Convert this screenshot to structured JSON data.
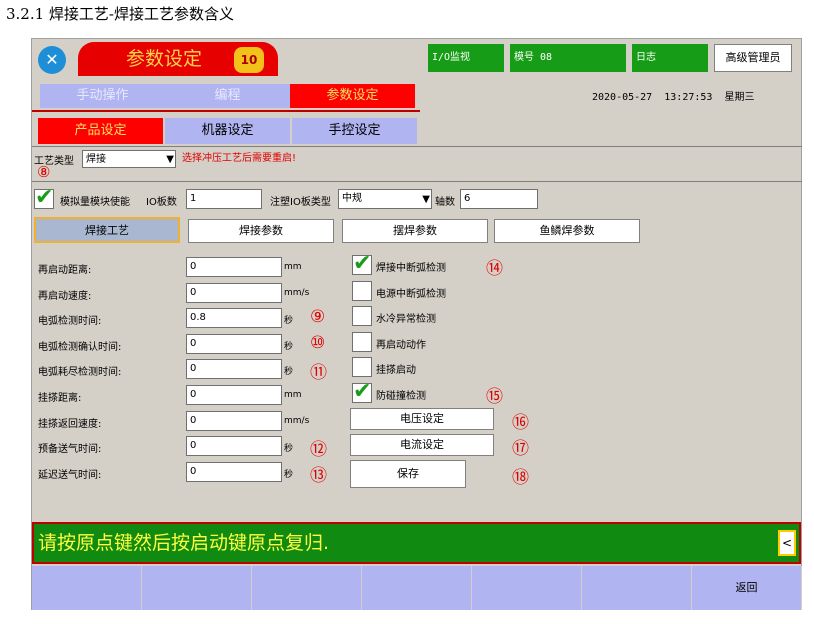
{
  "heading": "3.2.1 焊接工艺-焊接工艺参数含义",
  "top": {
    "title": "参数设定",
    "page_badge": "10",
    "io_monitor": "I/O监视",
    "model": "模号 08",
    "log": "日志",
    "admin": "高级管理员",
    "date": "2020-05-27",
    "time": "13:27:53",
    "weekday": "星期三"
  },
  "main_tabs": [
    "手动操作",
    "编程",
    "参数设定"
  ],
  "sub_tabs": [
    "产品设定",
    "机器设定",
    "手控设定"
  ],
  "process": {
    "label": "工艺类型",
    "value": "焊接",
    "warning": "选择冲压工艺后需要重启!",
    "marker": "⑧"
  },
  "config": {
    "analog_label": "模拟量模块使能",
    "io_count_label": "IO板数",
    "io_count_value": "1",
    "io_type_label": "注塑IO板类型",
    "io_type_value": "中规",
    "axis_label": "轴数",
    "axis_value": "6"
  },
  "section_tabs": [
    "焊接工艺",
    "焊接参数",
    "摆焊参数",
    "鱼鳞焊参数"
  ],
  "params": [
    {
      "label": "再启动距离:",
      "value": "0",
      "unit": "mm",
      "marker": ""
    },
    {
      "label": "再启动速度:",
      "value": "0",
      "unit": "mm/s",
      "marker": ""
    },
    {
      "label": "电弧检测时间:",
      "value": "0.8",
      "unit": "秒",
      "marker": "⑨"
    },
    {
      "label": "电弧检测确认时间:",
      "value": "0",
      "unit": "秒",
      "marker": "⑩"
    },
    {
      "label": "电弧耗尽检测时间:",
      "value": "0",
      "unit": "秒",
      "marker": "⑪"
    },
    {
      "label": "挂搽距离:",
      "value": "0",
      "unit": "mm",
      "marker": ""
    },
    {
      "label": "挂搽返回速度:",
      "value": "0",
      "unit": "mm/s",
      "marker": ""
    },
    {
      "label": "预备送气时间:",
      "value": "0",
      "unit": "秒",
      "marker": "⑫"
    },
    {
      "label": "延迟送气时间:",
      "value": "0",
      "unit": "秒",
      "marker": "⑬"
    }
  ],
  "checks": [
    {
      "label": "焊接中断弧检测",
      "checked": true,
      "marker": "⑭"
    },
    {
      "label": "电源中断弧检测",
      "checked": false,
      "marker": ""
    },
    {
      "label": "水冷异常检测",
      "checked": false,
      "marker": ""
    },
    {
      "label": "再启动动作",
      "checked": false,
      "marker": ""
    },
    {
      "label": "挂搽启动",
      "checked": false,
      "marker": ""
    },
    {
      "label": "防碰撞检测",
      "checked": true,
      "marker": "⑮"
    }
  ],
  "actions": [
    {
      "label": "电压设定",
      "marker": "⑯"
    },
    {
      "label": "电流设定",
      "marker": "⑰"
    },
    {
      "label": "保存",
      "marker": "⑱"
    }
  ],
  "status_message": "请按原点键然后按启动键原点复归.",
  "back_arrow": "<",
  "back_label": "返回"
}
